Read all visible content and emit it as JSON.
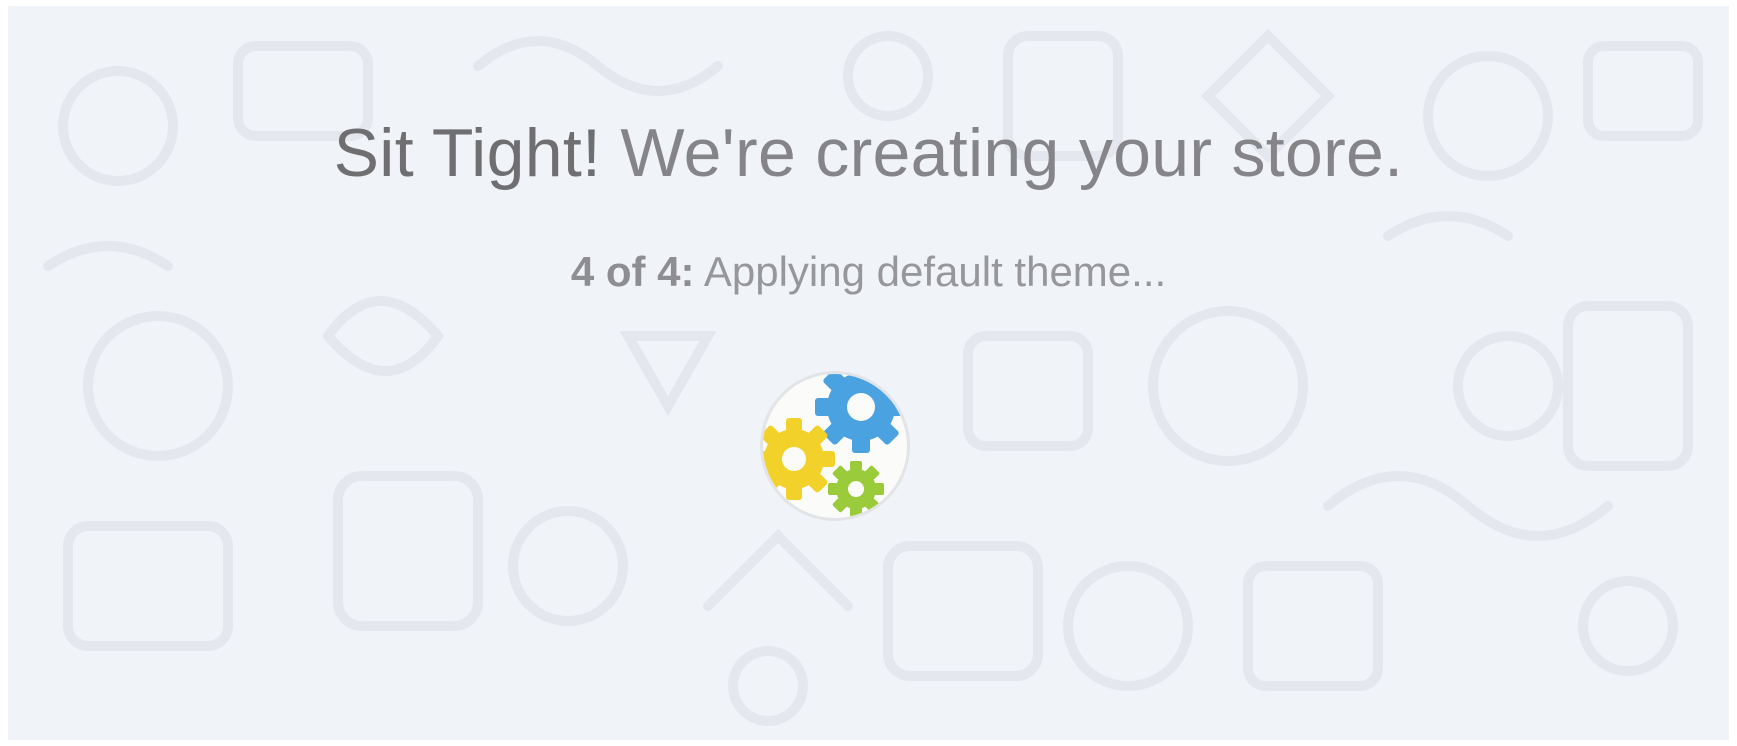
{
  "headline": {
    "strong": "Sit Tight!",
    "rest": " We're creating your store."
  },
  "progress": {
    "count_label": "4 of 4:",
    "step_label": " Applying default theme...",
    "current_step": 4,
    "total_steps": 4
  },
  "loader": {
    "icon": "gears-icon",
    "colors": {
      "blue": "#4aa3e0",
      "yellow": "#f2d12a",
      "green": "#9acb3a"
    }
  },
  "background": {
    "color": "#f0f3f7",
    "pattern_color": "#e6e9ee"
  }
}
